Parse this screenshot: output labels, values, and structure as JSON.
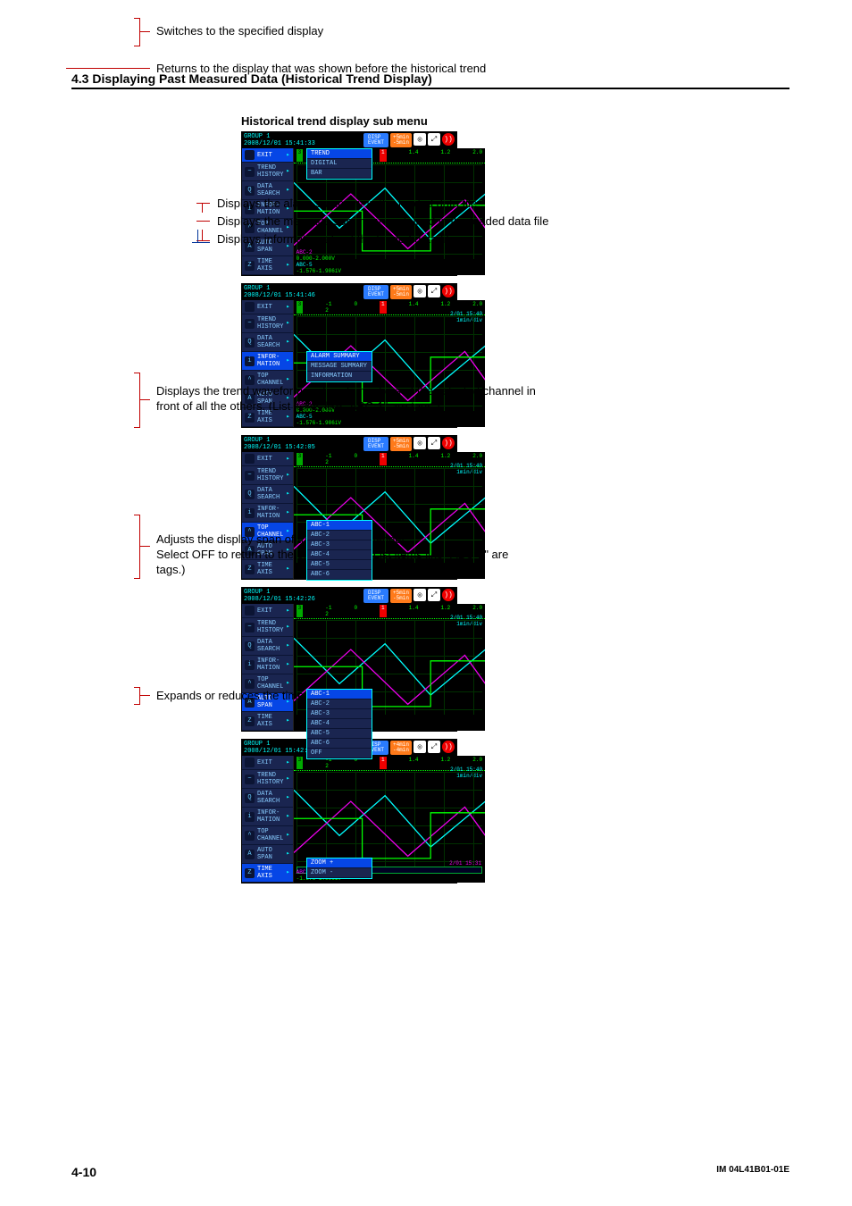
{
  "header": {
    "section": "4.3  Displaying Past Measured Data (Historical Trend Display)",
    "diagram_title": "Historical trend display sub menu"
  },
  "shots": [
    {
      "group": "GROUP 1",
      "datetime": "2008/12/01 15:41:33",
      "disp_top": "DISP",
      "disp_bot": "EVENT",
      "rate_top": "+5min",
      "rate_bot": "-5min",
      "menu_sel": 0,
      "submenu_at": 0,
      "submenu": [
        "TREND",
        "DIGITAL",
        "BAR"
      ],
      "submenu_sel": 0,
      "scale_stamp": "",
      "abc_a": "ABC-2",
      "abc_a2": "0.000-2.000V",
      "abc_b": "ABC-5",
      "abc_b2": "-1.576-1.986iV",
      "show_stamp": false,
      "show_slider": false
    },
    {
      "group": "GROUP 1",
      "datetime": "2008/12/01 15:41:46",
      "disp_top": "DISP",
      "disp_bot": "EVENT",
      "rate_top": "+5min",
      "rate_bot": "-5min",
      "menu_sel": 3,
      "submenu_at": 3,
      "submenu": [
        "ALARM SUMMARY",
        "MESSAGE SUMMARY",
        "INFORMATION"
      ],
      "submenu_sel": 0,
      "scale_stamp": "2/01 15:40\n1min/div",
      "abc_a": "ABC-2",
      "abc_a2": "0.000-2.000V",
      "abc_b": "ABC-5",
      "abc_b2": "-1.576-1.986iV",
      "show_stamp": true,
      "show_slider": false
    },
    {
      "group": "GROUP 1",
      "datetime": "2008/12/01 15:42:05",
      "disp_top": "DISP",
      "disp_bot": "EVENT",
      "rate_top": "+5min",
      "rate_bot": "-5min",
      "menu_sel": 4,
      "submenu_at": 4,
      "submenu": [
        "ABC-1",
        "ABC-2",
        "ABC-3",
        "ABC-4",
        "ABC-5",
        "ABC-6"
      ],
      "submenu_sel": 0,
      "scale_stamp": "2/01 15:40\n1min/div",
      "abc_a": "",
      "abc_a2": "",
      "abc_b": "",
      "abc_b2": "",
      "show_stamp": true,
      "show_slider": false
    },
    {
      "group": "GROUP 1",
      "datetime": "2008/12/01 15:42:26",
      "disp_top": "DISP",
      "disp_bot": "EVENT",
      "rate_top": "+5min",
      "rate_bot": "-5min",
      "menu_sel": 5,
      "submenu_at": 5,
      "submenu": [
        "ABC-1",
        "ABC-2",
        "ABC-3",
        "ABC-4",
        "ABC-5",
        "ABC-6",
        "OFF"
      ],
      "submenu_sel": 0,
      "scale_stamp": "2/01 15:40\n1min/div",
      "abc_a": "",
      "abc_a2": "",
      "abc_b": "",
      "abc_b2": "",
      "show_stamp": true,
      "show_slider": false
    },
    {
      "group": "GROUP 1",
      "datetime": "2008/12/01 15:42:39",
      "disp_top": "DISP",
      "disp_bot": "EVENT",
      "rate_top": "+4min",
      "rate_bot": "-4min",
      "menu_sel": 6,
      "submenu_at": 6,
      "submenu": [
        "ZOOM +",
        "ZOOM -"
      ],
      "submenu_sel": 0,
      "scale_stamp": "2/01 15:40\n1min/div",
      "abc_a": "ABC-5",
      "abc_a2": "-1.576-1.986iV",
      "abc_b": "",
      "abc_b2": "",
      "show_stamp": true,
      "show_slider": true,
      "slider_time": "2/01 15:31"
    }
  ],
  "menu_items": [
    {
      "icon": "",
      "label": "EXIT"
    },
    {
      "icon": "~",
      "label": "TREND\nHISTORY"
    },
    {
      "icon": "Q",
      "label": "DATA\nSEARCH"
    },
    {
      "icon": "i",
      "label": "INFOR-\nMATION"
    },
    {
      "icon": "^",
      "label": "TOP\nCHANNEL"
    },
    {
      "icon": "A",
      "label": "AUTO\nSPAN"
    },
    {
      "icon": "Z",
      "label": "TIME\nAXIS"
    }
  ],
  "scale": {
    "nums": [
      "3",
      "-1",
      "2",
      "0",
      "1",
      "1.4",
      "1.2",
      "2.0"
    ]
  },
  "annotations": {
    "a1": "Switches to the specified display",
    "a2": "Returns to the display that was shown before the historical trend",
    "b1": "Displays the alarm summary in the loaded data file",
    "b2": "Displays the message summary contained in the loaded data file",
    "b3": "Displays information about the loaded data file",
    "c1": "Displays the trend waveform and scale markers of the selected channel in front of all the others. (List items like \"ABC-1\" are tags.)",
    "d1": "Adjusts the display span of the selected channel.",
    "d2": "Select OFF to return to the original span. (List items like \"ABC-1\" are tags.)",
    "e1": "Expands or reduces the time axis"
  },
  "footer": {
    "page": "4-10",
    "doc": "IM 04L41B01-01E"
  }
}
